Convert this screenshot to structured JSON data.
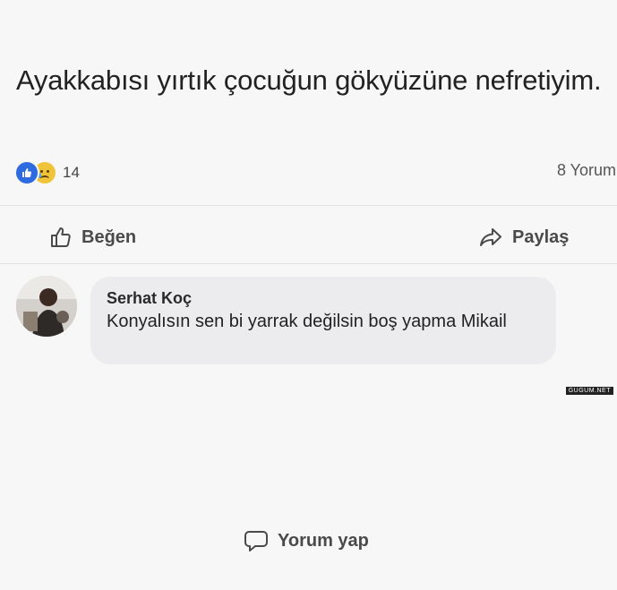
{
  "post": {
    "text": "Ayakkabısı yırtık çocuğun gökyüzüne nefretiyim."
  },
  "stats": {
    "reaction_icons": [
      "like-icon",
      "sad-icon"
    ],
    "reaction_count": "14",
    "comment_count": "8 Yorum"
  },
  "actions": {
    "like_label": "Beğen",
    "comment_label": "Yorum yap",
    "share_label": "Paylaş"
  },
  "comment": {
    "author": "Serhat Koç",
    "text": "Konyalısın sen bi yarrak değilsin boş yapma Mikail"
  },
  "colors": {
    "like_blue": "#2f6be0",
    "sad_yellow": "#f0c43a",
    "bubble": "#ececee"
  },
  "watermark": "GUGUM.NET"
}
